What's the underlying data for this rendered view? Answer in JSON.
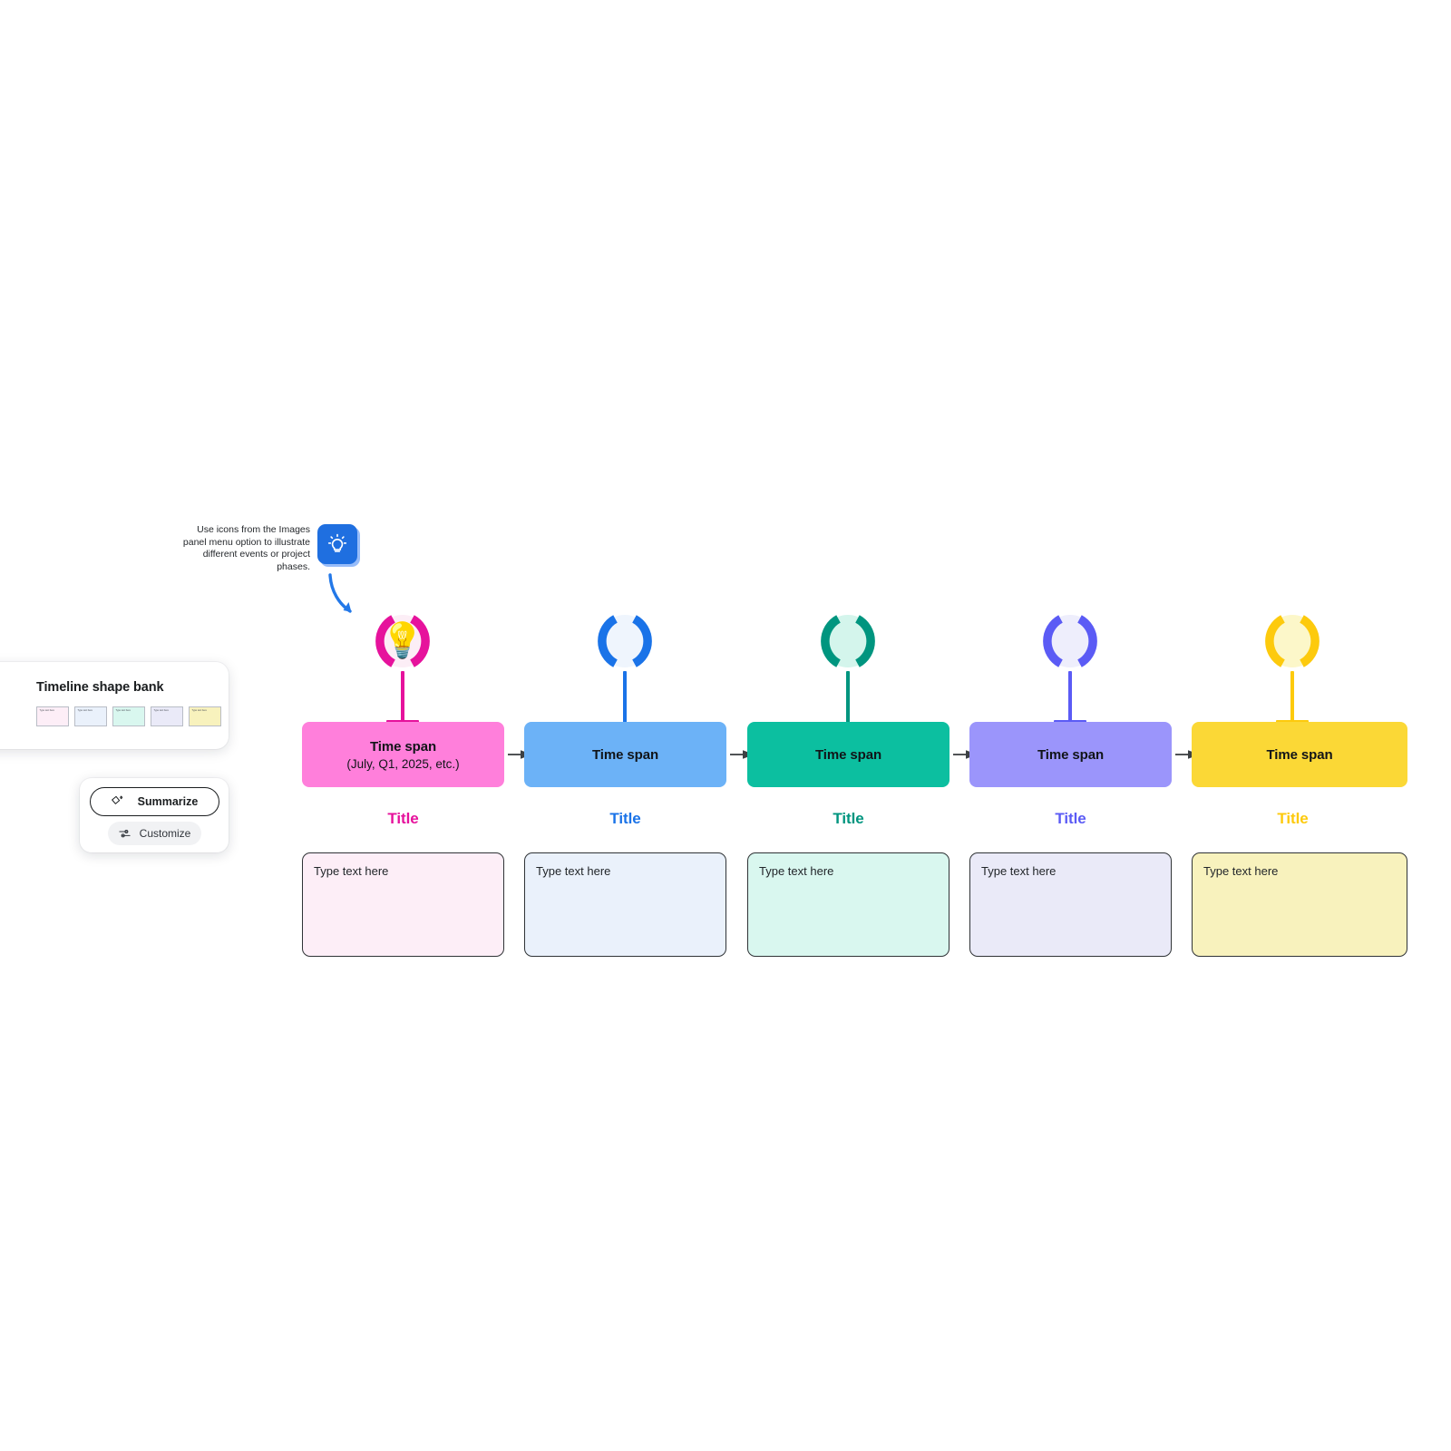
{
  "hint": {
    "text": "Use icons from the Images panel menu option to illustrate different events or project phases.",
    "badge_icon": "lightbulb-icon",
    "badge_color": "#1f6fe0",
    "arrow_icon": "curved-arrow-icon",
    "arrow_color": "#2378e8"
  },
  "shape_bank": {
    "title": "Timeline shape bank",
    "mini_cards": [
      {
        "label": "Type text here",
        "fill": "#fdeef7",
        "border": "#b9bdc6"
      },
      {
        "label": "Type text here",
        "fill": "#eaf1fb",
        "border": "#b9bdc6"
      },
      {
        "label": "Type text here",
        "fill": "#d9f7ef",
        "border": "#b9bdc6"
      },
      {
        "label": "Type text here",
        "fill": "#eaeaf8",
        "border": "#b9bdc6"
      },
      {
        "label": "Type text here",
        "fill": "#f8f2bd",
        "border": "#b9bdc6"
      }
    ]
  },
  "toolbar": {
    "summarize_label": "Summarize",
    "summarize_icon": "sparkle-icon",
    "customize_label": "Customize",
    "customize_icon": "sliders-icon"
  },
  "timeline": {
    "arrow_color": "#3c4043",
    "steps": [
      {
        "accent": "#e6129c",
        "node_fill": "#fceef6",
        "node_emoji": "💡",
        "node_icon": "lightbulb-emoji",
        "card_fill": "#ff7fdb",
        "span_title": "Time span",
        "span_subtitle": "(July, Q1, 2025, etc.)",
        "title": "Title",
        "title_color": "#e6129c",
        "box_fill": "#fdeef7",
        "box_placeholder": "Type text here"
      },
      {
        "accent": "#1a73e8",
        "node_fill": "#eff5fd",
        "node_emoji": "",
        "node_icon": "empty-node-icon",
        "card_fill": "#6cb2f7",
        "span_title": "Time span",
        "span_subtitle": "",
        "title": "Title",
        "title_color": "#1a73e8",
        "box_fill": "#eaf1fb",
        "box_placeholder": "Type text here"
      },
      {
        "accent": "#00957f",
        "node_fill": "#d4f5ec",
        "node_emoji": "",
        "node_icon": "empty-node-icon",
        "card_fill": "#0cbfa0",
        "span_title": "Time span",
        "span_subtitle": "",
        "title": "Title",
        "title_color": "#00957f",
        "box_fill": "#d9f7ef",
        "box_placeholder": "Type text here"
      },
      {
        "accent": "#5b5bf5",
        "node_fill": "#eeeefc",
        "node_emoji": "",
        "node_icon": "empty-node-icon",
        "card_fill": "#9b95fb",
        "span_title": "Time span",
        "span_subtitle": "",
        "title": "Title",
        "title_color": "#5b5bf5",
        "box_fill": "#eaeaf8",
        "box_placeholder": "Type text here"
      },
      {
        "accent": "#fdca0d",
        "node_fill": "#fcf7c9",
        "node_emoji": "",
        "node_icon": "empty-node-icon",
        "card_fill": "#fbd836",
        "span_title": "Time span",
        "span_subtitle": "",
        "title": "Title",
        "title_color": "#fdca0d",
        "box_fill": "#f8f2bd",
        "box_placeholder": "Type text here"
      }
    ]
  }
}
